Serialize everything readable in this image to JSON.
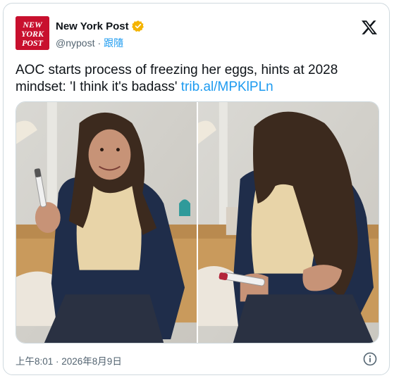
{
  "author": {
    "display_name": "New York Post",
    "handle": "@nypost",
    "separator": "·",
    "follow_label": "跟隨",
    "logo_lines": [
      "NEW",
      "YORK",
      "POST"
    ],
    "verified_color": "#f4b400",
    "logo_color": "#c8102e"
  },
  "tweet": {
    "text": "AOC starts process of freezing her eggs, hints at 2028 mindset: 'I think it's badass' ",
    "link": "trib.al/MPKlPLn"
  },
  "media": {
    "photos": [
      {
        "name": "photo-left",
        "description_icon": "woman-holding-pen-photo"
      },
      {
        "name": "photo-right",
        "description_icon": "woman-injecting-photo"
      }
    ]
  },
  "meta": {
    "timestamp": "上午8:01 · 2026年8月9日"
  },
  "colors": {
    "link": "#1d9bf0",
    "secondary_text": "#536471",
    "border": "#cfd9de"
  }
}
